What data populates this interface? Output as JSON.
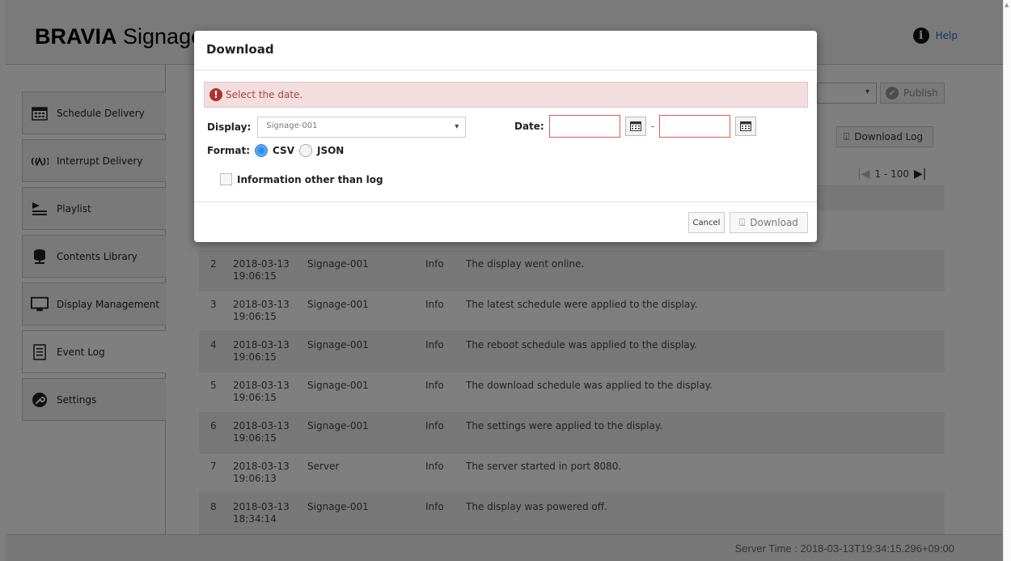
{
  "app": {
    "brand_bold": "BRAVIA",
    "brand_rest": " Signage",
    "help_label": "Help"
  },
  "sidebar": {
    "items": [
      {
        "label": "Schedule Delivery",
        "icon": "calendar-icon"
      },
      {
        "label": "Interrupt Delivery",
        "icon": "broadcast-icon"
      },
      {
        "label": "Playlist",
        "icon": "playlist-icon"
      },
      {
        "label": "Contents Library",
        "icon": "database-icon"
      },
      {
        "label": "Display Management",
        "icon": "monitor-icon"
      },
      {
        "label": "Event Log",
        "icon": "document-icon"
      },
      {
        "label": "Settings",
        "icon": "wrench-icon"
      }
    ]
  },
  "toolbar": {
    "publish_label": "Publish",
    "download_log_label": "Download Log",
    "pager_text": "1 - 100"
  },
  "log": {
    "rows": [
      {
        "no": "2",
        "date": "2018-03-13",
        "time": "19:06:15",
        "source": "Signage-001",
        "level": "Info",
        "message": "The display went online."
      },
      {
        "no": "3",
        "date": "2018-03-13",
        "time": "19:06:15",
        "source": "Signage-001",
        "level": "Info",
        "message": "The latest schedule were applied to the display."
      },
      {
        "no": "4",
        "date": "2018-03-13",
        "time": "19:06:15",
        "source": "Signage-001",
        "level": "Info",
        "message": "The reboot schedule was applied to the display."
      },
      {
        "no": "5",
        "date": "2018-03-13",
        "time": "19:06:15",
        "source": "Signage-001",
        "level": "Info",
        "message": "The download schedule was applied to the display."
      },
      {
        "no": "6",
        "date": "2018-03-13",
        "time": "19:06:15",
        "source": "Signage-001",
        "level": "Info",
        "message": "The settings were applied to the display."
      },
      {
        "no": "7",
        "date": "2018-03-13",
        "time": "19:06:13",
        "source": "Server",
        "level": "Info",
        "message": "The server started in port 8080."
      },
      {
        "no": "8",
        "date": "2018-03-13",
        "time": "18:34:14",
        "source": "Signage-001",
        "level": "Info",
        "message": "The display was powered off."
      }
    ]
  },
  "footer": {
    "server_time": "Server Time : 2018-03-13T19:34:15.296+09:00"
  },
  "modal": {
    "title": "Download",
    "alert": "Select the date.",
    "display_label": "Display:",
    "display_value": "Signage-001",
    "date_label": "Date:",
    "date_from": "",
    "date_to": "",
    "date_sep": "-",
    "format_label": "Format:",
    "format_csv": "CSV",
    "format_json": "JSON",
    "format_selected": "CSV",
    "info_label": "Information other than log",
    "info_checked": false,
    "cancel_label": "Cancel",
    "download_label": "Download"
  },
  "colors": {
    "accent": "#2f8be6",
    "alert_bg": "#f2dede",
    "alert_text": "#a94442",
    "error_border": "#e05a5a",
    "link": "#1a6fd0"
  }
}
